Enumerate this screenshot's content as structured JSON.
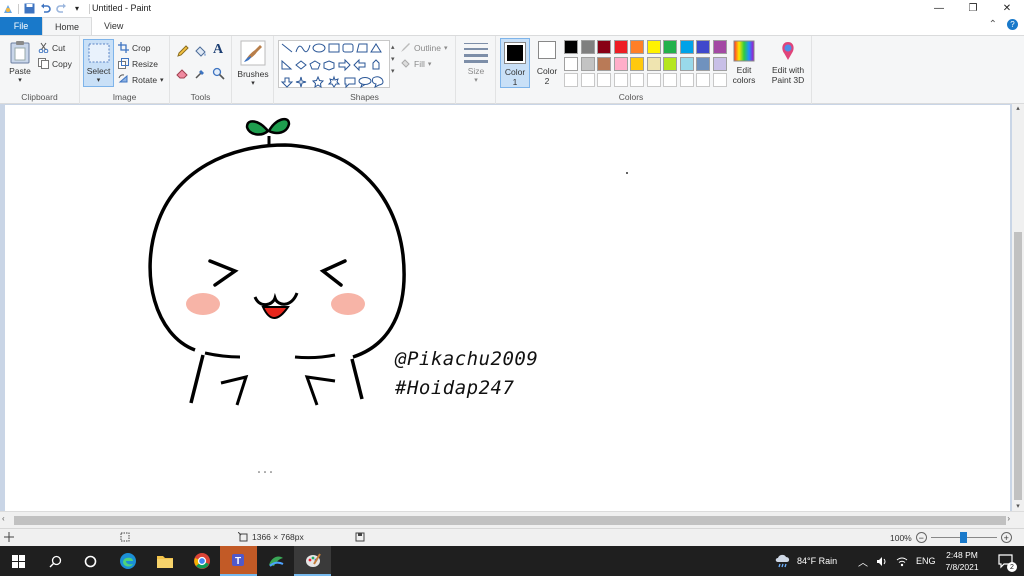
{
  "window": {
    "title": "Untitled - Paint"
  },
  "tabs": [
    {
      "label": "File"
    },
    {
      "label": "Home"
    },
    {
      "label": "View"
    }
  ],
  "clipboard": {
    "paste": "Paste",
    "cut": "Cut",
    "copy": "Copy",
    "group": "Clipboard"
  },
  "image": {
    "select": "Select",
    "crop": "Crop",
    "resize": "Resize",
    "rotate": "Rotate",
    "group": "Image"
  },
  "tools": {
    "group": "Tools"
  },
  "brushes": {
    "label": "Brushes"
  },
  "shapes": {
    "outline": "Outline",
    "fill": "Fill",
    "group": "Shapes"
  },
  "size": {
    "label": "Size"
  },
  "colors": {
    "color1": "Color",
    "color1_num": "1",
    "color2": "Color",
    "color2_num": "2",
    "edit": "Edit",
    "edit2": "colors",
    "paint3d": "Edit with",
    "paint3d2": "Paint 3D",
    "group": "Colors",
    "row1": [
      "#000000",
      "#7f7f7f",
      "#880015",
      "#ed1c24",
      "#ff7f27",
      "#fff200",
      "#22b14c",
      "#00a2e8",
      "#3f48cc",
      "#a349a4"
    ],
    "row2": [
      "#ffffff",
      "#c3c3c3",
      "#b97a57",
      "#ffaec9",
      "#ffc90e",
      "#efe4b0",
      "#b5e61d",
      "#99d9ea",
      "#7092be",
      "#c8bfe7"
    ]
  },
  "canvas": {
    "handle": "@Pikachu2009",
    "tag": "#Hoidap247"
  },
  "status": {
    "dimensions": "1366 × 768px",
    "zoom": "100%"
  },
  "taskbar": {
    "weather": "84°F Rain",
    "lang": "ENG",
    "time": "2:48 PM",
    "date": "7/8/2021",
    "notif_count": "2"
  }
}
